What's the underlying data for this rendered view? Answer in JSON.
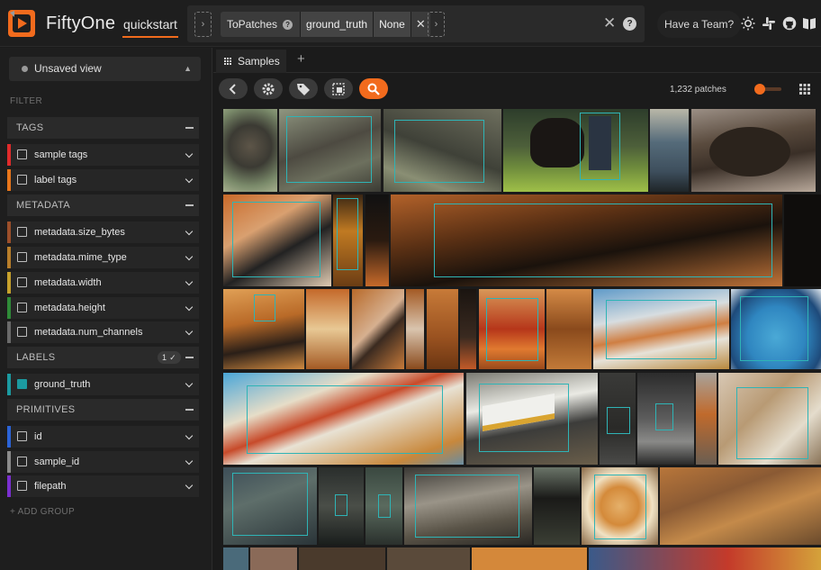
{
  "header": {
    "brand": "FiftyOne",
    "dataset_name": "quickstart",
    "view_bar": {
      "stage_name": "ToPatches",
      "stage_field": "ground_truth",
      "stage_config": "None"
    },
    "team_button": "Have a Team?",
    "icons": [
      "sun-icon",
      "slack-icon",
      "github-icon",
      "docs-icon"
    ]
  },
  "sidebar": {
    "view_selector": "Unsaved view",
    "filter_label": "FILTER",
    "groups": {
      "tags": "TAGS",
      "metadata": "METADATA",
      "labels": "LABELS",
      "labels_badge": "1 ✓",
      "primitives": "PRIMITIVES"
    },
    "rows": {
      "sample_tags": "sample tags",
      "label_tags": "label tags",
      "size_bytes": "metadata.size_bytes",
      "mime_type": "metadata.mime_type",
      "width": "metadata.width",
      "height": "metadata.height",
      "num_channels": "metadata.num_channels",
      "ground_truth": "ground_truth",
      "id": "id",
      "sample_id": "sample_id",
      "filepath": "filepath"
    },
    "add_group": "+ ADD GROUP",
    "colors": {
      "sample_tags": "#e02b2b",
      "label_tags": "#e8761b",
      "size_bytes": "#9c4f2a",
      "mime_type": "#b87e2a",
      "width": "#c7a12c",
      "height": "#2f8a38",
      "num_channels": "#6a6a6a",
      "ground_truth": "#1b9aa0",
      "id": "#2b63d6",
      "sample_id": "#8a8a8a",
      "filepath": "#7b2fd0"
    }
  },
  "main": {
    "tab_label": "Samples",
    "patch_count": "1,232 patches",
    "accent": "#f26b1d"
  }
}
